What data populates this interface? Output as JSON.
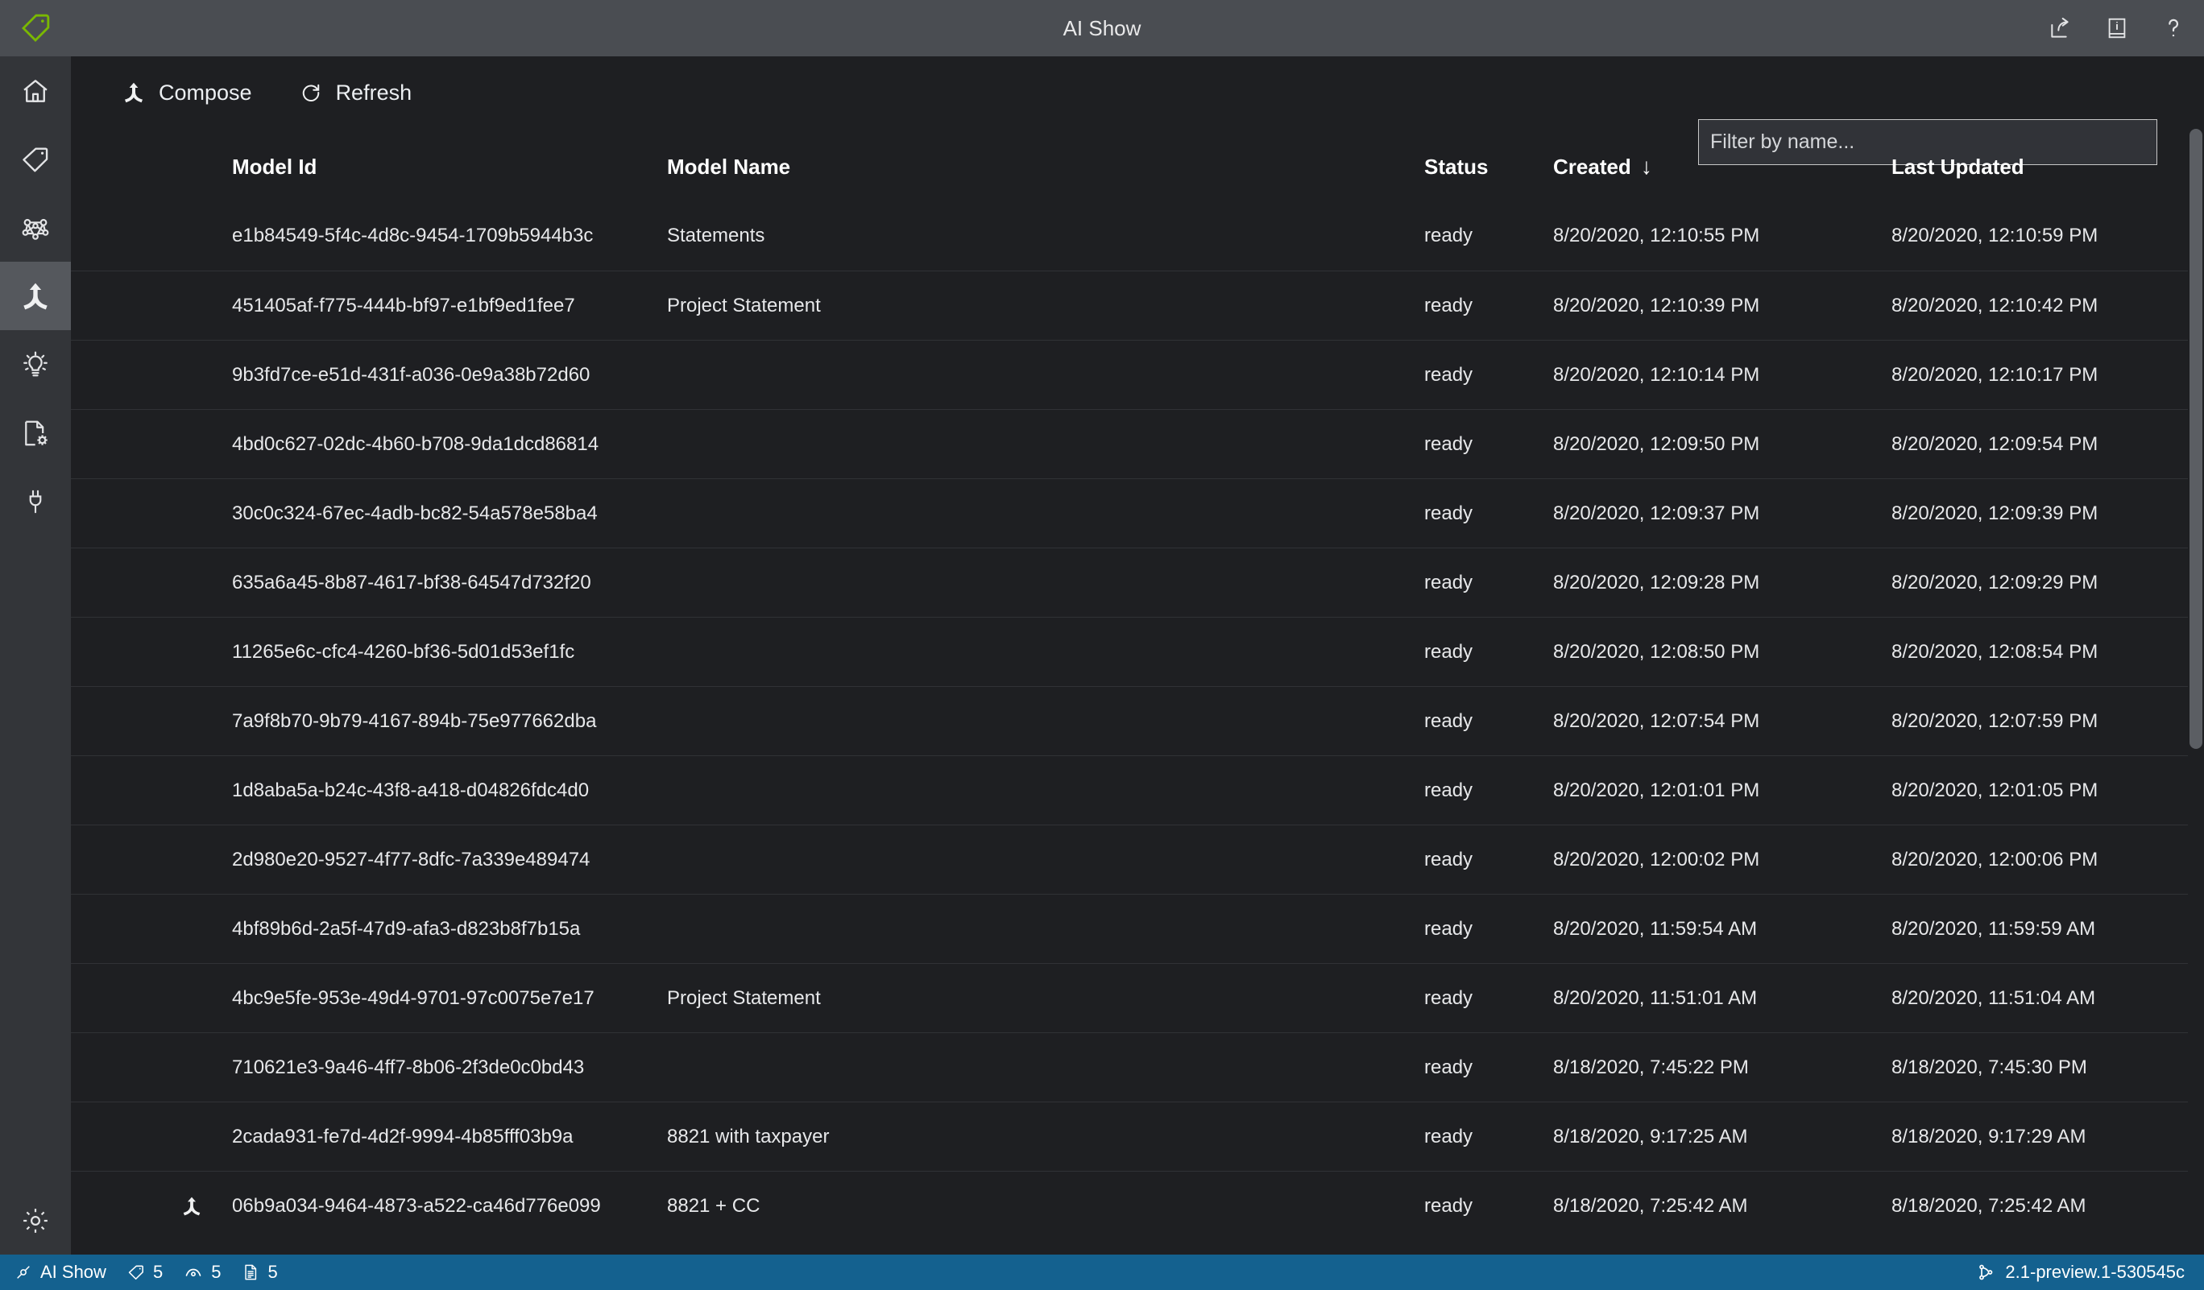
{
  "window": {
    "title": "AI Show",
    "logo_icon": "tag-logo-icon",
    "logo_color": "#7ab800",
    "actions": [
      {
        "name": "share-icon",
        "label": "Share"
      },
      {
        "name": "documentation-icon",
        "label": "Documentation"
      },
      {
        "name": "help-icon",
        "label": "Help"
      }
    ]
  },
  "sidebar": {
    "items": [
      {
        "name": "home",
        "icon": "home-icon",
        "selected": false
      },
      {
        "name": "tags",
        "icon": "tag-icon",
        "selected": false
      },
      {
        "name": "models",
        "icon": "network-graph-icon",
        "selected": false
      },
      {
        "name": "compose",
        "icon": "compose-merge-icon",
        "selected": true
      },
      {
        "name": "insights",
        "icon": "lightbulb-icon",
        "selected": false
      },
      {
        "name": "document-settings",
        "icon": "document-gear-icon",
        "selected": false
      },
      {
        "name": "connections",
        "icon": "plug-icon",
        "selected": false
      }
    ],
    "bottom": [
      {
        "name": "settings",
        "icon": "gear-icon",
        "selected": false
      }
    ]
  },
  "toolbar": {
    "compose_label": "Compose",
    "compose_icon": "compose-merge-icon",
    "refresh_label": "Refresh",
    "refresh_icon": "refresh-icon"
  },
  "filter": {
    "placeholder": "Filter by name...",
    "value": ""
  },
  "table": {
    "columns": [
      {
        "key": "icon",
        "label": ""
      },
      {
        "key": "model_id",
        "label": "Model Id"
      },
      {
        "key": "model_name",
        "label": "Model Name"
      },
      {
        "key": "status",
        "label": "Status"
      },
      {
        "key": "created",
        "label": "Created",
        "sorted": true,
        "sort_arrow": "↓"
      },
      {
        "key": "last_updated",
        "label": "Last Updated"
      }
    ],
    "rows": [
      {
        "icon": "",
        "model_id": "e1b84549-5f4c-4d8c-9454-1709b5944b3c",
        "model_name": "Statements",
        "status": "ready",
        "created": "8/20/2020, 12:10:55 PM",
        "last_updated": "8/20/2020, 12:10:59 PM"
      },
      {
        "icon": "",
        "model_id": "451405af-f775-444b-bf97-e1bf9ed1fee7",
        "model_name": "Project Statement",
        "status": "ready",
        "created": "8/20/2020, 12:10:39 PM",
        "last_updated": "8/20/2020, 12:10:42 PM"
      },
      {
        "icon": "",
        "model_id": "9b3fd7ce-e51d-431f-a036-0e9a38b72d60",
        "model_name": "",
        "status": "ready",
        "created": "8/20/2020, 12:10:14 PM",
        "last_updated": "8/20/2020, 12:10:17 PM"
      },
      {
        "icon": "",
        "model_id": "4bd0c627-02dc-4b60-b708-9da1dcd86814",
        "model_name": "",
        "status": "ready",
        "created": "8/20/2020, 12:09:50 PM",
        "last_updated": "8/20/2020, 12:09:54 PM"
      },
      {
        "icon": "",
        "model_id": "30c0c324-67ec-4adb-bc82-54a578e58ba4",
        "model_name": "",
        "status": "ready",
        "created": "8/20/2020, 12:09:37 PM",
        "last_updated": "8/20/2020, 12:09:39 PM"
      },
      {
        "icon": "",
        "model_id": "635a6a45-8b87-4617-bf38-64547d732f20",
        "model_name": "",
        "status": "ready",
        "created": "8/20/2020, 12:09:28 PM",
        "last_updated": "8/20/2020, 12:09:29 PM"
      },
      {
        "icon": "",
        "model_id": "11265e6c-cfc4-4260-bf36-5d01d53ef1fc",
        "model_name": "",
        "status": "ready",
        "created": "8/20/2020, 12:08:50 PM",
        "last_updated": "8/20/2020, 12:08:54 PM"
      },
      {
        "icon": "",
        "model_id": "7a9f8b70-9b79-4167-894b-75e977662dba",
        "model_name": "",
        "status": "ready",
        "created": "8/20/2020, 12:07:54 PM",
        "last_updated": "8/20/2020, 12:07:59 PM"
      },
      {
        "icon": "",
        "model_id": "1d8aba5a-b24c-43f8-a418-d04826fdc4d0",
        "model_name": "",
        "status": "ready",
        "created": "8/20/2020, 12:01:01 PM",
        "last_updated": "8/20/2020, 12:01:05 PM"
      },
      {
        "icon": "",
        "model_id": "2d980e20-9527-4f77-8dfc-7a339e489474",
        "model_name": "",
        "status": "ready",
        "created": "8/20/2020, 12:00:02 PM",
        "last_updated": "8/20/2020, 12:00:06 PM"
      },
      {
        "icon": "",
        "model_id": "4bf89b6d-2a5f-47d9-afa3-d823b8f7b15a",
        "model_name": "",
        "status": "ready",
        "created": "8/20/2020, 11:59:54 AM",
        "last_updated": "8/20/2020, 11:59:59 AM"
      },
      {
        "icon": "",
        "model_id": "4bc9e5fe-953e-49d4-9701-97c0075e7e17",
        "model_name": "Project Statement",
        "status": "ready",
        "created": "8/20/2020, 11:51:01 AM",
        "last_updated": "8/20/2020, 11:51:04 AM"
      },
      {
        "icon": "",
        "model_id": "710621e3-9a46-4ff7-8b06-2f3de0c0bd43",
        "model_name": "",
        "status": "ready",
        "created": "8/18/2020, 7:45:22 PM",
        "last_updated": "8/18/2020, 7:45:30 PM"
      },
      {
        "icon": "",
        "model_id": "2cada931-fe7d-4d2f-9994-4b85fff03b9a",
        "model_name": "8821 with taxpayer",
        "status": "ready",
        "created": "8/18/2020, 9:17:25 AM",
        "last_updated": "8/18/2020, 9:17:29 AM"
      },
      {
        "icon": "compose-merge-icon",
        "model_id": "06b9a034-9464-4873-a522-ca46d776e099",
        "model_name": "8821 + CC",
        "status": "ready",
        "created": "8/18/2020, 7:25:42 AM",
        "last_updated": "8/18/2020, 7:25:42 AM"
      }
    ]
  },
  "statusbar": {
    "background": "#14618f",
    "connection_icon": "plug-icon",
    "connection_label": "AI Show",
    "counts": [
      {
        "icon": "tag-icon",
        "value": "5"
      },
      {
        "icon": "eye-icon",
        "value": "5"
      },
      {
        "icon": "document-icon",
        "value": "5"
      }
    ],
    "version_icon": "branch-icon",
    "version": "2.1-preview.1-530545c"
  }
}
